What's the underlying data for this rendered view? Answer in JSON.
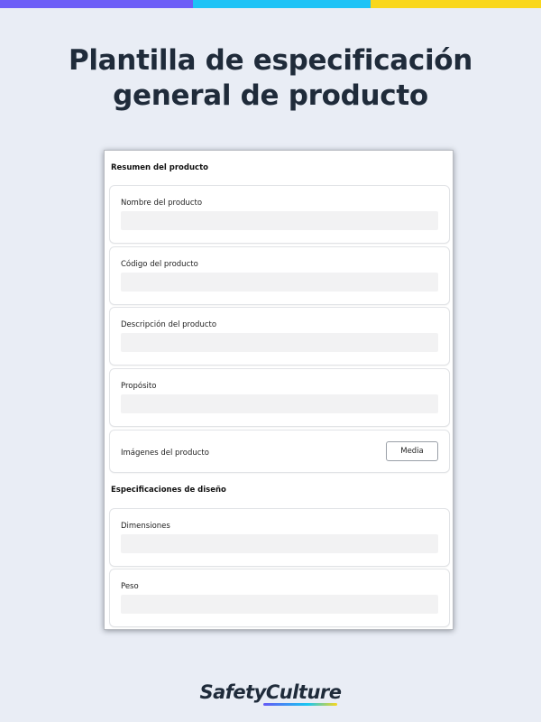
{
  "colors": {
    "bar_segments": [
      "#6d5ef7",
      "#1ec3f6",
      "#f9d71c"
    ],
    "background": "#e9edf5",
    "title": "#1f2b3a"
  },
  "page": {
    "title_line1": "Plantilla de especificación",
    "title_line2": "general de producto"
  },
  "form": {
    "section1_title": "Resumen del producto",
    "fields": [
      {
        "label": "Nombre del producto",
        "value": ""
      },
      {
        "label": "Código del producto",
        "value": ""
      },
      {
        "label": "Descripción del producto",
        "value": ""
      },
      {
        "label": "Propósito",
        "value": ""
      }
    ],
    "media_field": {
      "label": "Imágenes del producto",
      "button": "Media"
    },
    "section2_title": "Especificaciones de diseño",
    "design_fields": [
      {
        "label": "Dimensiones",
        "value": ""
      },
      {
        "label": "Peso",
        "value": ""
      }
    ]
  },
  "brand": {
    "part1": "Safety",
    "part2": "Culture"
  }
}
